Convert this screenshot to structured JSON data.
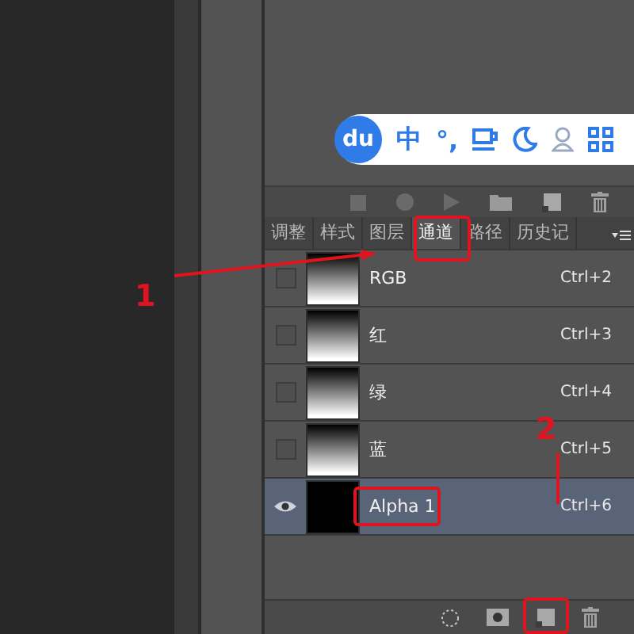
{
  "ime_toolbar": {
    "logo": "du",
    "mode": "中",
    "punctuation": "°,"
  },
  "tabs": [
    {
      "label": "调整",
      "selected": false
    },
    {
      "label": "样式",
      "selected": false
    },
    {
      "label": "图层",
      "selected": false
    },
    {
      "label": "通道",
      "selected": true
    },
    {
      "label": "路径",
      "selected": false
    },
    {
      "label": "历史记",
      "selected": false
    }
  ],
  "channels": [
    {
      "kind": "color",
      "name": "RGB",
      "shortcut": "Ctrl+2",
      "visible": false,
      "selected": false
    },
    {
      "kind": "color",
      "name": "红",
      "shortcut": "Ctrl+3",
      "visible": false,
      "selected": false
    },
    {
      "kind": "color",
      "name": "绿",
      "shortcut": "Ctrl+4",
      "visible": false,
      "selected": false
    },
    {
      "kind": "color",
      "name": "蓝",
      "shortcut": "Ctrl+5",
      "visible": false,
      "selected": false
    },
    {
      "kind": "alpha",
      "name": "Alpha 1",
      "shortcut": "Ctrl+6",
      "visible": true,
      "selected": true
    }
  ],
  "annotations": [
    {
      "kind": "step",
      "text": "1"
    },
    {
      "kind": "step",
      "text": "2"
    }
  ]
}
